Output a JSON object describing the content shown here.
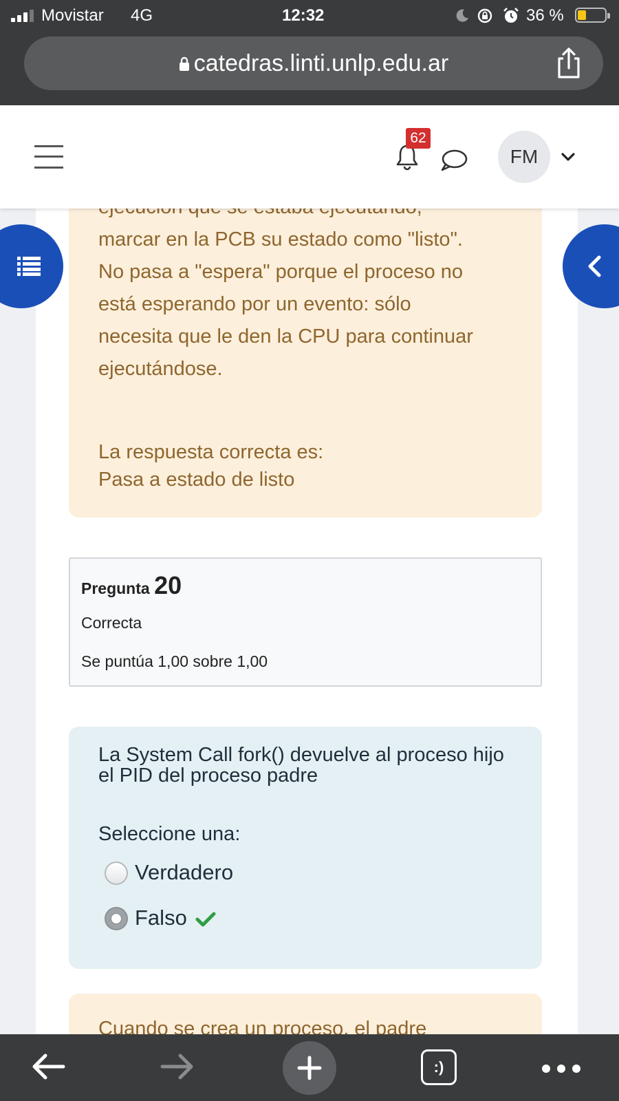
{
  "status_bar": {
    "carrier": "Movistar",
    "network": "4G",
    "time": "12:32",
    "battery": "36 %"
  },
  "browser": {
    "url": "catedras.linti.unlp.edu.ar"
  },
  "header": {
    "notification_count": "62",
    "user_initials": "FM"
  },
  "feedback": {
    "text": "contexto para salvar la integridad de la\nejecución que se estaba ejecutando,\nmarcar en la PCB su estado como \"listo\".\nNo pasa a \"espera\" porque el proceso no\nestá esperando por un evento: sólo\nnecesita que le den la CPU para continuar\nejecutándose.",
    "right_answer_label": "La respuesta correcta es:",
    "right_answer": "Pasa a estado de listo"
  },
  "question": {
    "label": "Pregunta",
    "number": "20",
    "state": "Correcta",
    "grade": "Se puntúa 1,00 sobre 1,00",
    "prompt": "La System Call fork() devuelve al proceso hijo el PID del proceso padre",
    "select_label": "Seleccione una:",
    "options": [
      {
        "label": "Verdadero",
        "selected": false
      },
      {
        "label": "Falso",
        "selected": true,
        "correct": true
      }
    ]
  },
  "next_feedback": {
    "text": "Cuando se crea un proceso, el padre"
  },
  "colors": {
    "primary": "#1b4fb8",
    "feedback_bg": "#fcefdc",
    "feedback_text": "#8e662e",
    "question_bg": "#e5f0f4",
    "badge": "#d32f2f",
    "correct": "#2e9e44"
  }
}
